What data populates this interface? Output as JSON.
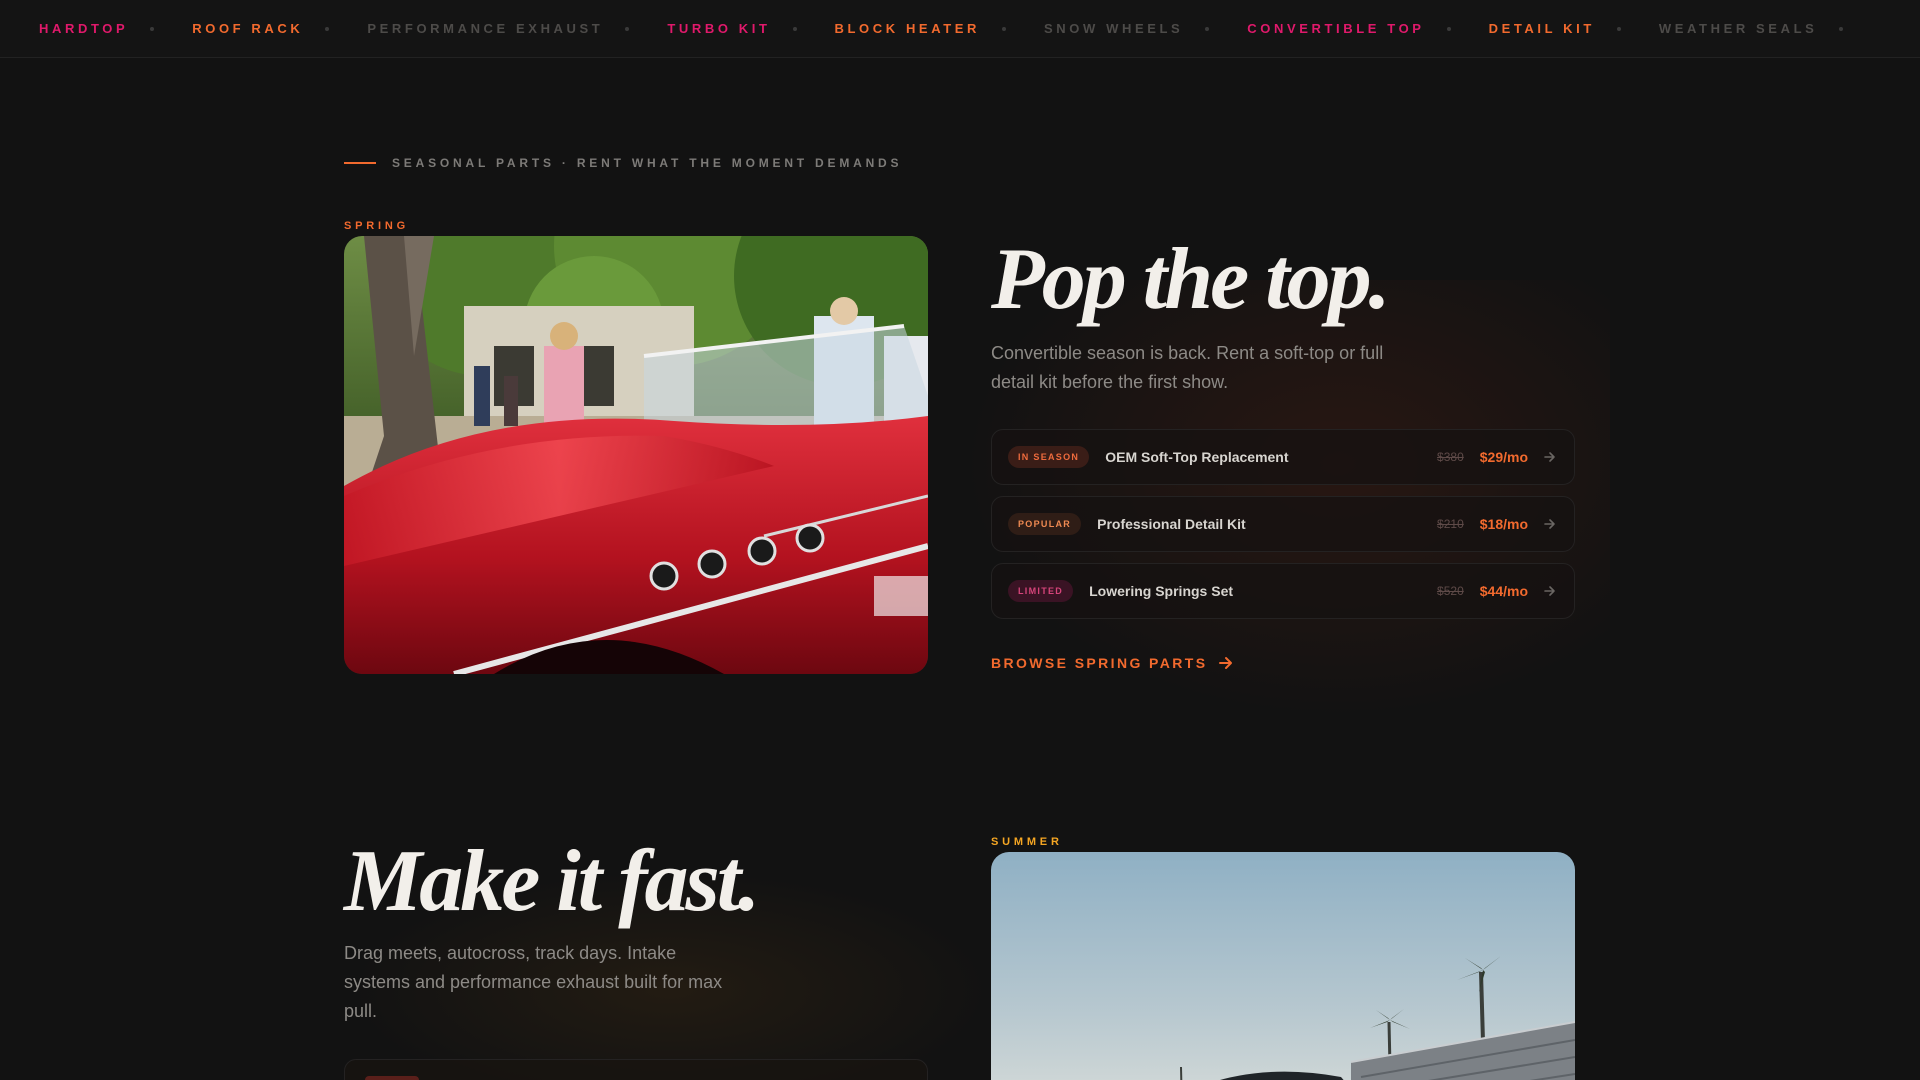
{
  "ticker": [
    {
      "label": "HARDTOP",
      "color": "#e0196b"
    },
    {
      "label": "ROOF RACK",
      "color": "#f26a2e"
    },
    {
      "label": "PERFORMANCE EXHAUST",
      "color": "#4d4b49"
    },
    {
      "label": "TURBO KIT",
      "color": "#e0196b"
    },
    {
      "label": "BLOCK HEATER",
      "color": "#f26a2e"
    },
    {
      "label": "SNOW WHEELS",
      "color": "#4d4b49"
    },
    {
      "label": "CONVERTIBLE TOP",
      "color": "#e0196b"
    },
    {
      "label": "DETAIL KIT",
      "color": "#f26a2e"
    },
    {
      "label": "WEATHER SEALS",
      "color": "#4d4b49"
    }
  ],
  "eyebrow": {
    "text": "SEASONAL PARTS · RENT WHAT THE MOMENT DEMANDS",
    "accent": "#f26a2e"
  },
  "spring": {
    "tag": "SPRING",
    "tag_color": "#f26a2e",
    "headline": "Pop the top.",
    "lede": "Convertible season is back. Rent a soft-top or full detail kit before the first show.",
    "offers": [
      {
        "badge": "IN SEASON",
        "badge_color": "#ef6b3d",
        "badge_bg": "#3a1d17",
        "name": "OEM Soft-Top Replacement",
        "old_price": "$380",
        "price": "$29/mo"
      },
      {
        "badge": "POPULAR",
        "badge_color": "#ef8a52",
        "badge_bg": "#2f1d16",
        "name": "Professional Detail Kit",
        "old_price": "$210",
        "price": "$18/mo"
      },
      {
        "badge": "LIMITED",
        "badge_color": "#d6447a",
        "badge_bg": "#3a1324",
        "name": "Lowering Springs Set",
        "old_price": "$520",
        "price": "$44/mo"
      }
    ],
    "price_color": "#f26a2e",
    "cta": "BROWSE SPRING PARTS"
  },
  "summer": {
    "tag": "SUMMER",
    "tag_color": "#f5a623",
    "headline": "Make it fast.",
    "lede": "Drag meets, autocross, track days. Intake systems and performance exhaust built for max pull."
  }
}
